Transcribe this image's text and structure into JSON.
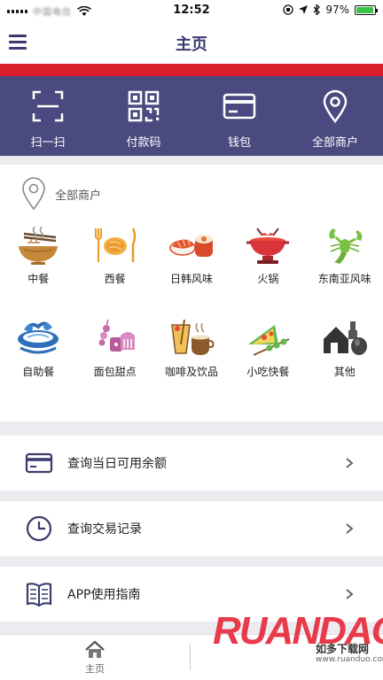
{
  "status": {
    "carrier": "中国电信",
    "time": "12:52",
    "battery": "97%",
    "battery_level": 0.97
  },
  "nav": {
    "title": "主页"
  },
  "actions": [
    {
      "label": "扫一扫",
      "icon": "scan-icon"
    },
    {
      "label": "付款码",
      "icon": "qr-code-icon"
    },
    {
      "label": "钱包",
      "icon": "wallet-card-icon"
    },
    {
      "label": "全部商户",
      "icon": "location-pin-icon"
    }
  ],
  "merchants": {
    "header_label": "全部商户",
    "categories": [
      {
        "label": "中餐",
        "icon": "noodle-bowl-icon"
      },
      {
        "label": "西餐",
        "icon": "western-food-icon"
      },
      {
        "label": "日韩风味",
        "icon": "sushi-icon"
      },
      {
        "label": "火锅",
        "icon": "hotpot-icon"
      },
      {
        "label": "东南亚风味",
        "icon": "lobster-icon"
      },
      {
        "label": "自助餐",
        "icon": "buffet-icon"
      },
      {
        "label": "面包甜点",
        "icon": "dessert-icon"
      },
      {
        "label": "咖啡及饮品",
        "icon": "coffee-icon"
      },
      {
        "label": "小吃快餐",
        "icon": "snack-icon"
      },
      {
        "label": "其他",
        "icon": "other-icon"
      }
    ]
  },
  "list": [
    {
      "label": "查询当日可用余额",
      "icon": "card-icon"
    },
    {
      "label": "查询交易记录",
      "icon": "clock-icon"
    },
    {
      "label": "APP使用指南",
      "icon": "book-icon"
    }
  ],
  "tabbar": {
    "home_label": "主页"
  },
  "watermark": {
    "logo": "RUANDAO",
    "sub": "如多下载网",
    "url": "www.ruanduo.com"
  },
  "colors": {
    "accent": "#4a4a80",
    "red_band": "#d71e2a",
    "watermark": "#e83a4a"
  }
}
